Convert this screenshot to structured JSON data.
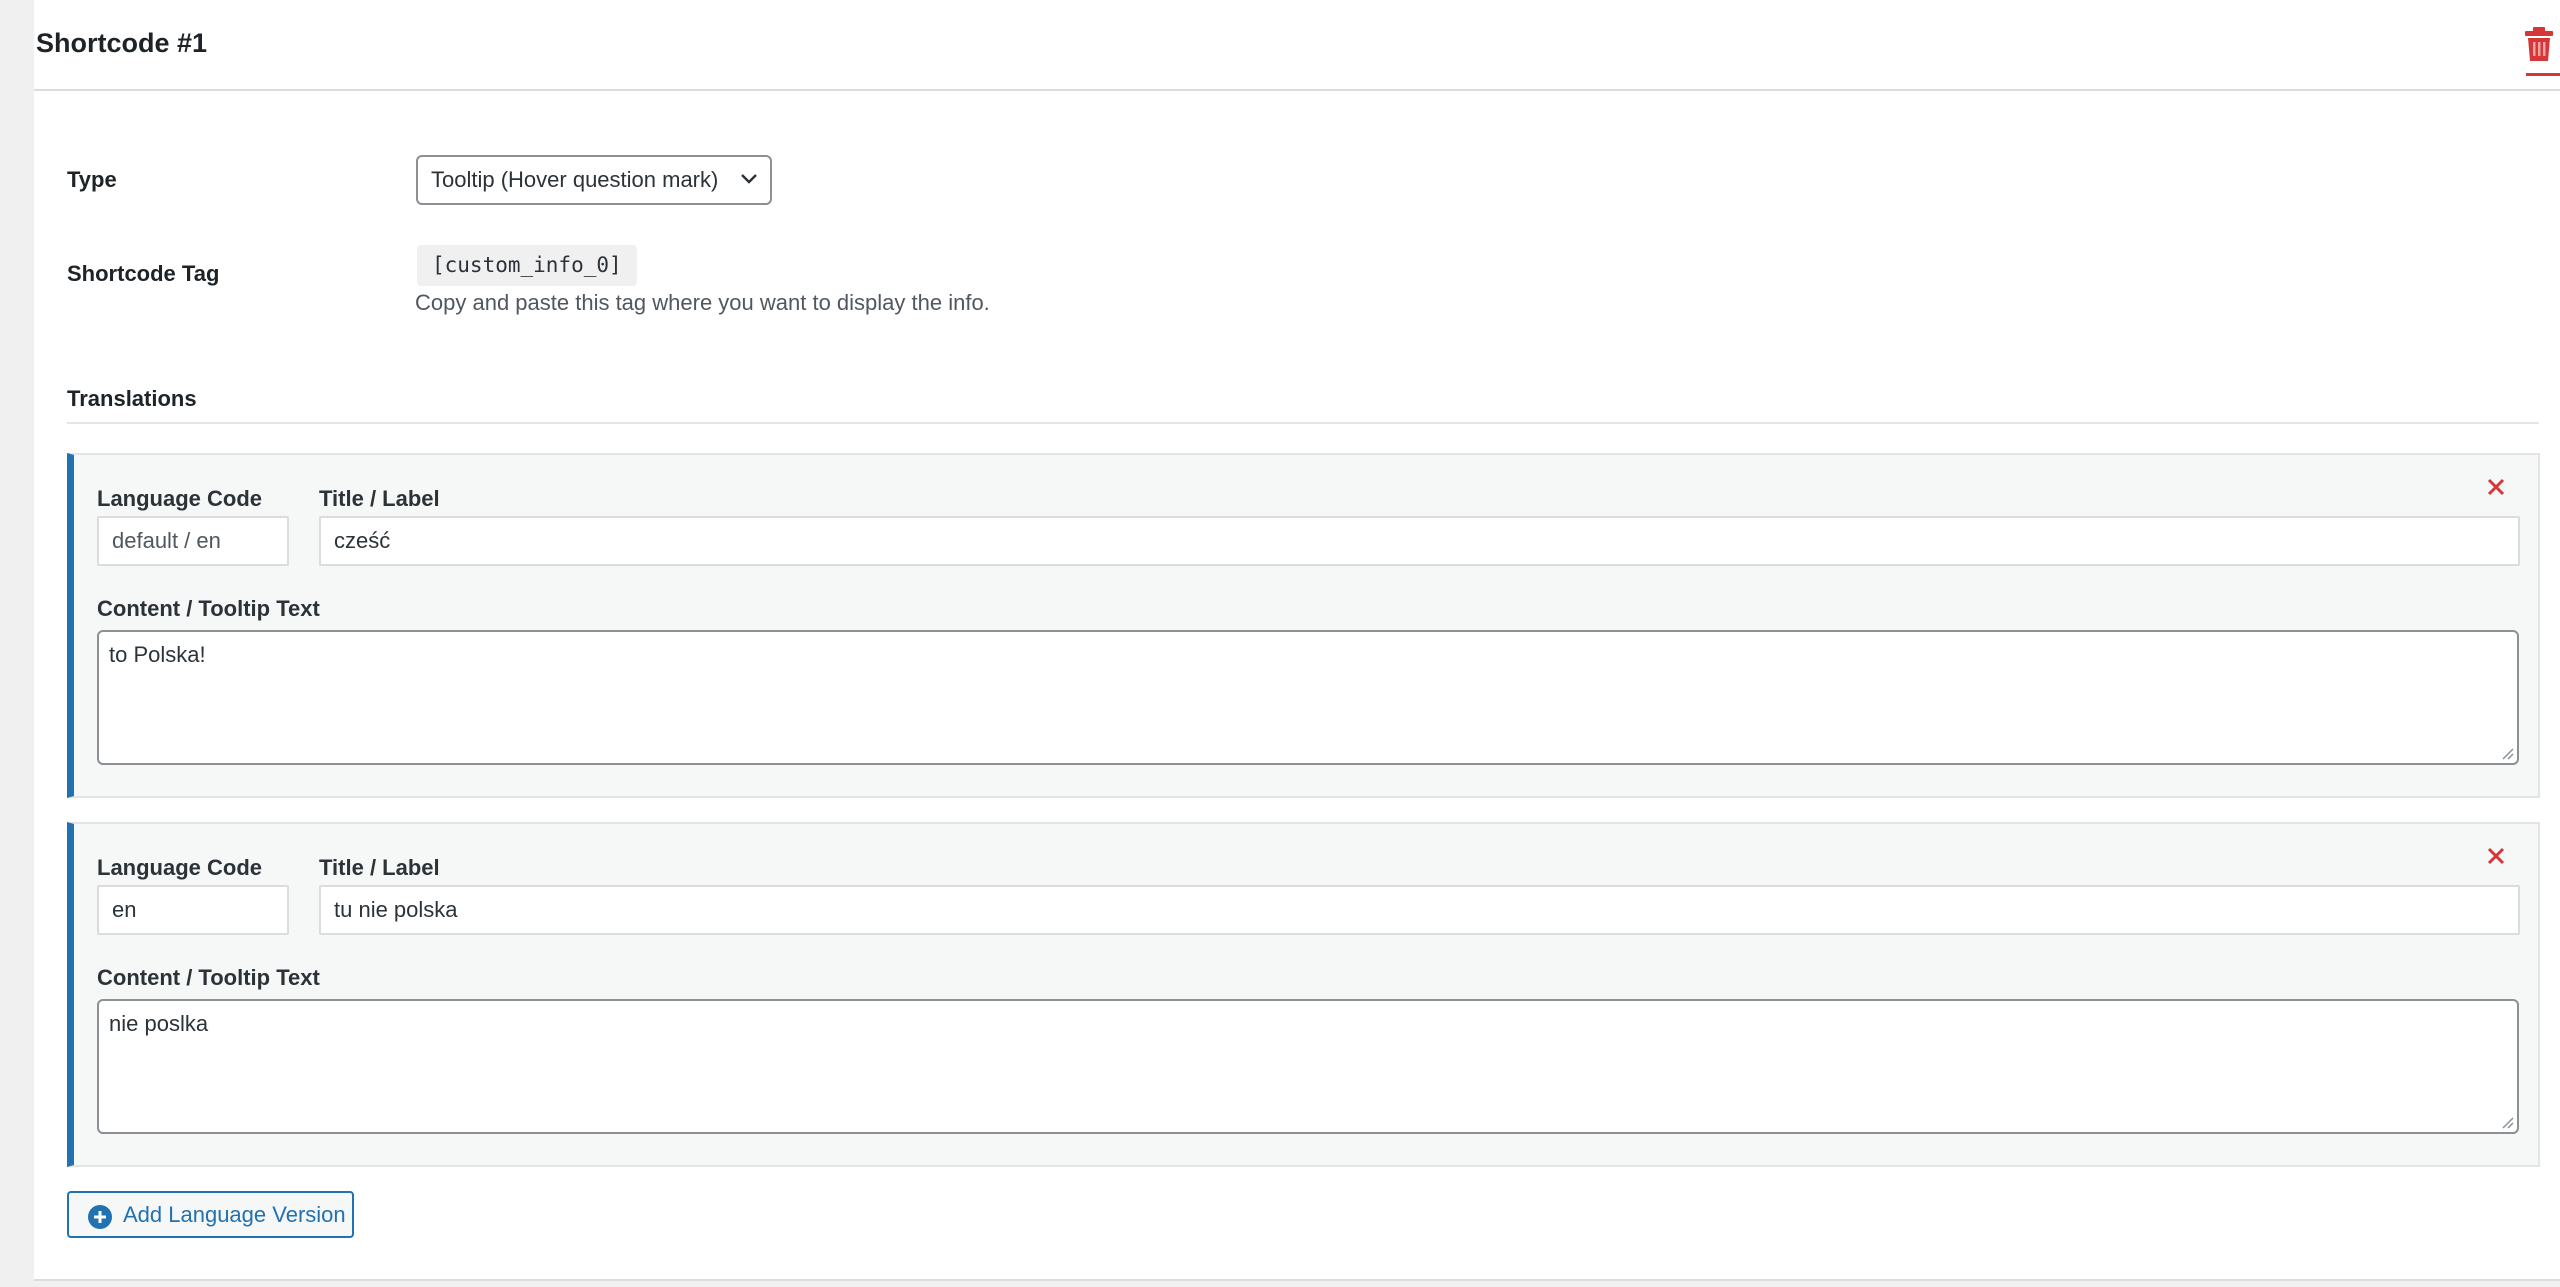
{
  "header": {
    "title": "Shortcode #1",
    "delete_icon": "trash-icon"
  },
  "fields": {
    "type_label": "Type",
    "type_value": "Tooltip (Hover question mark)",
    "shortcode_label": "Shortcode Tag",
    "shortcode_value": "[custom_info_0]",
    "shortcode_help": "Copy and paste this tag where you want to display the info."
  },
  "translations": {
    "title": "Translations",
    "items": [
      {
        "language_code_label": "Language Code",
        "language_code": "default / en",
        "title_label": "Title / Label",
        "title_value": "cześć",
        "content_label": "Content / Tooltip Text",
        "content_value": "to Polska!"
      },
      {
        "language_code_label": "Language Code",
        "language_code": "en",
        "title_label": "Title / Label",
        "title_value": "tu nie polska",
        "content_label": "Content / Tooltip Text",
        "content_value": "nie poslka"
      }
    ],
    "add_button": "Add Language Version"
  },
  "colors": {
    "accent": "#2271b1",
    "danger": "#d63638"
  }
}
